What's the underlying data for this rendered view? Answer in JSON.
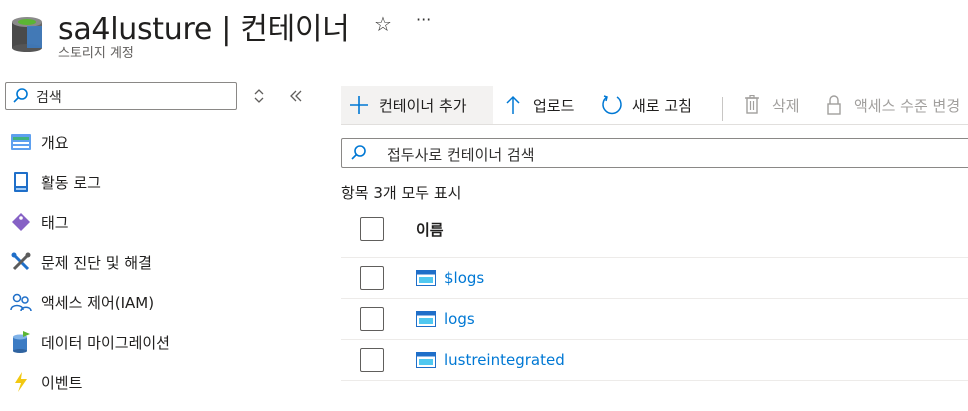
{
  "header": {
    "title": "sa4lusture | 컨테이너",
    "subtitle": "스토리지 계정",
    "favorite_icon": "star-icon",
    "more_label": "···"
  },
  "sidebar": {
    "search_placeholder": "검색",
    "items": [
      {
        "label": "개요",
        "icon": "overview-icon"
      },
      {
        "label": "활동 로그",
        "icon": "activity-log-icon"
      },
      {
        "label": "태그",
        "icon": "tag-icon"
      },
      {
        "label": "문제 진단 및 해결",
        "icon": "wrench-icon"
      },
      {
        "label": "액세스 제어(IAM)",
        "icon": "people-icon"
      },
      {
        "label": "데이터 마이그레이션",
        "icon": "migration-icon"
      },
      {
        "label": "이벤트",
        "icon": "lightning-icon"
      }
    ]
  },
  "toolbar": {
    "add_container": "컨테이너 추가",
    "upload": "업로드",
    "refresh": "새로 고침",
    "delete": "삭제",
    "change_access": "액세스 수준 변경"
  },
  "filter": {
    "placeholder": "접두사로 컨테이너 검색"
  },
  "list": {
    "count_text": "항목 3개 모두 표시",
    "column_name": "이름",
    "rows": [
      {
        "name": "$logs"
      },
      {
        "name": "logs"
      },
      {
        "name": "lustreintegrated"
      }
    ]
  },
  "colors": {
    "accent": "#0078d4",
    "link": "#0078d4"
  }
}
